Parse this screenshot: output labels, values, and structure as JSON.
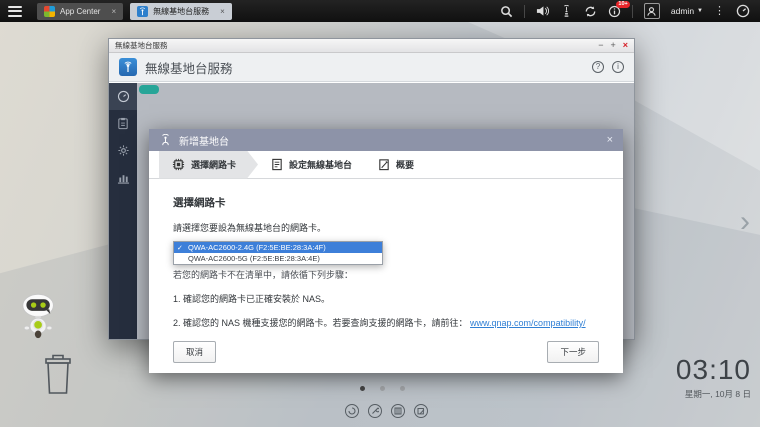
{
  "icons": {
    "close": "×",
    "caret": "▼",
    "check": "✓",
    "kebab": "⋮",
    "question": "?",
    "info": "i",
    "chevron_right": "›"
  },
  "taskbar": {
    "tabs": [
      {
        "label": "App Center"
      },
      {
        "label": "無線基地台服務"
      }
    ],
    "user_label": "admin",
    "notification_badge": "10+"
  },
  "window": {
    "titlebar_title": "無線基地台服務",
    "controls": {
      "minimize": "−",
      "maximize": "+",
      "close": "×"
    },
    "app_title": "無線基地台服務"
  },
  "wizard": {
    "title": "新增基地台",
    "steps": [
      {
        "label": "選擇網路卡"
      },
      {
        "label": "設定無線基地台"
      },
      {
        "label": "概要"
      }
    ],
    "heading": "選擇網路卡",
    "instruction": "請選擇您要設為無線基地台的網路卡。",
    "dropdown_options": [
      {
        "label": "QWA-AC2600-2.4G (F2:5E:BE:28:3A:4F)",
        "selected": true
      },
      {
        "label": "QWA-AC2600-5G (F2:5E:BE:28:3A:4E)",
        "selected": false
      }
    ],
    "note": "若您的網路卡不在清單中，請依循下列步驟：",
    "steps_text": [
      "1. 確認您的網路卡已正確安裝於 NAS。",
      "2. 確認您的 NAS 機種支援您的網路卡。若要查詢支援的網路卡，請前往："
    ],
    "link": "www.qnap.com/compatibility/",
    "cancel_label": "取消",
    "next_label": "下一步"
  },
  "desktop": {
    "clock_time": "03:10",
    "clock_date": "星期一, 10月 8 日"
  },
  "colors": {
    "accent_blue": "#2e80cc",
    "selected_row": "#3d7fd9",
    "modal_header": "#8d93a8",
    "badge_red": "#e8252a",
    "link_blue": "#2f7fd4",
    "sidebar_navy": "#262e3e"
  }
}
